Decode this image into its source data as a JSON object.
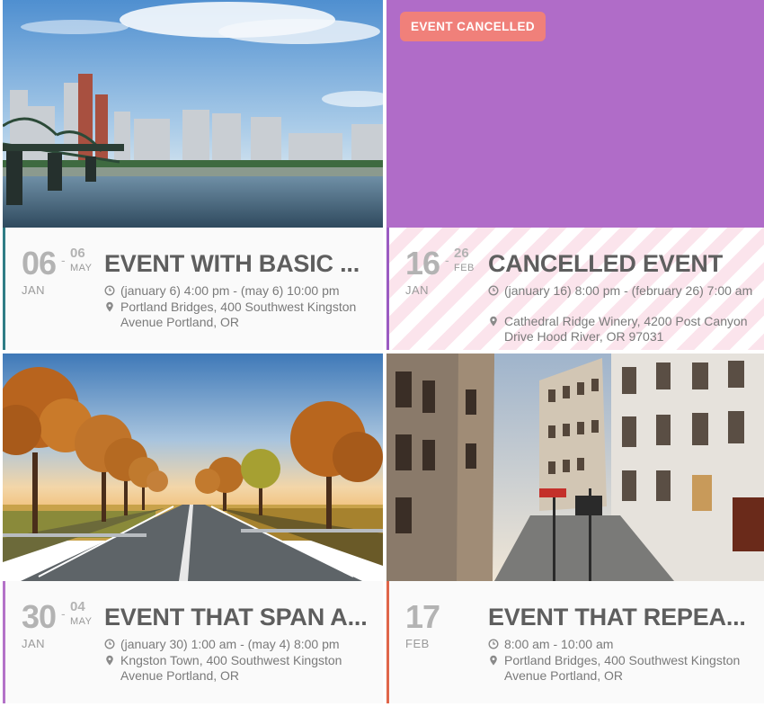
{
  "events": [
    {
      "start_day": "06",
      "start_month": "JAN",
      "end_day": "06",
      "end_month": "MAY",
      "title": "EVENT WITH BASIC ...",
      "time": "(january 6) 4:00 pm - (may 6) 10:00 pm",
      "location": "Portland Bridges, 400 Southwest Kingston Avenue Portland, OR",
      "accent": "#2f7d86"
    },
    {
      "badge": "EVENT CANCELLED",
      "start_day": "16",
      "start_month": "JAN",
      "end_day": "26",
      "end_month": "FEB",
      "title": "CANCELLED EVENT",
      "time": "(january 16) 8:00 pm - (february 26) 7:00 am",
      "location": "Cathedral Ridge Winery, 4200 Post Canyon Drive Hood River, OR 97031",
      "accent": "#9b5bc2",
      "image_color": "#b06cc8",
      "badge_color": "#f0807a"
    },
    {
      "start_day": "30",
      "start_month": "JAN",
      "end_day": "04",
      "end_month": "MAY",
      "title": "EVENT THAT SPAN A...",
      "time": "(january 30) 1:00 am - (may 4) 8:00 pm",
      "location": "Kngston Town, 400 Southwest Kingston Avenue Portland, OR",
      "accent": "#b472c8"
    },
    {
      "start_day": "17",
      "start_month": "FEB",
      "title": "EVENT THAT REPEA...",
      "time": "8:00 am - 10:00 am",
      "location": "Portland Bridges, 400 Southwest Kingston Avenue Portland, OR",
      "accent": "#e0664a"
    }
  ],
  "icons": {
    "time": "clock-icon",
    "location": "map-pin-icon"
  }
}
